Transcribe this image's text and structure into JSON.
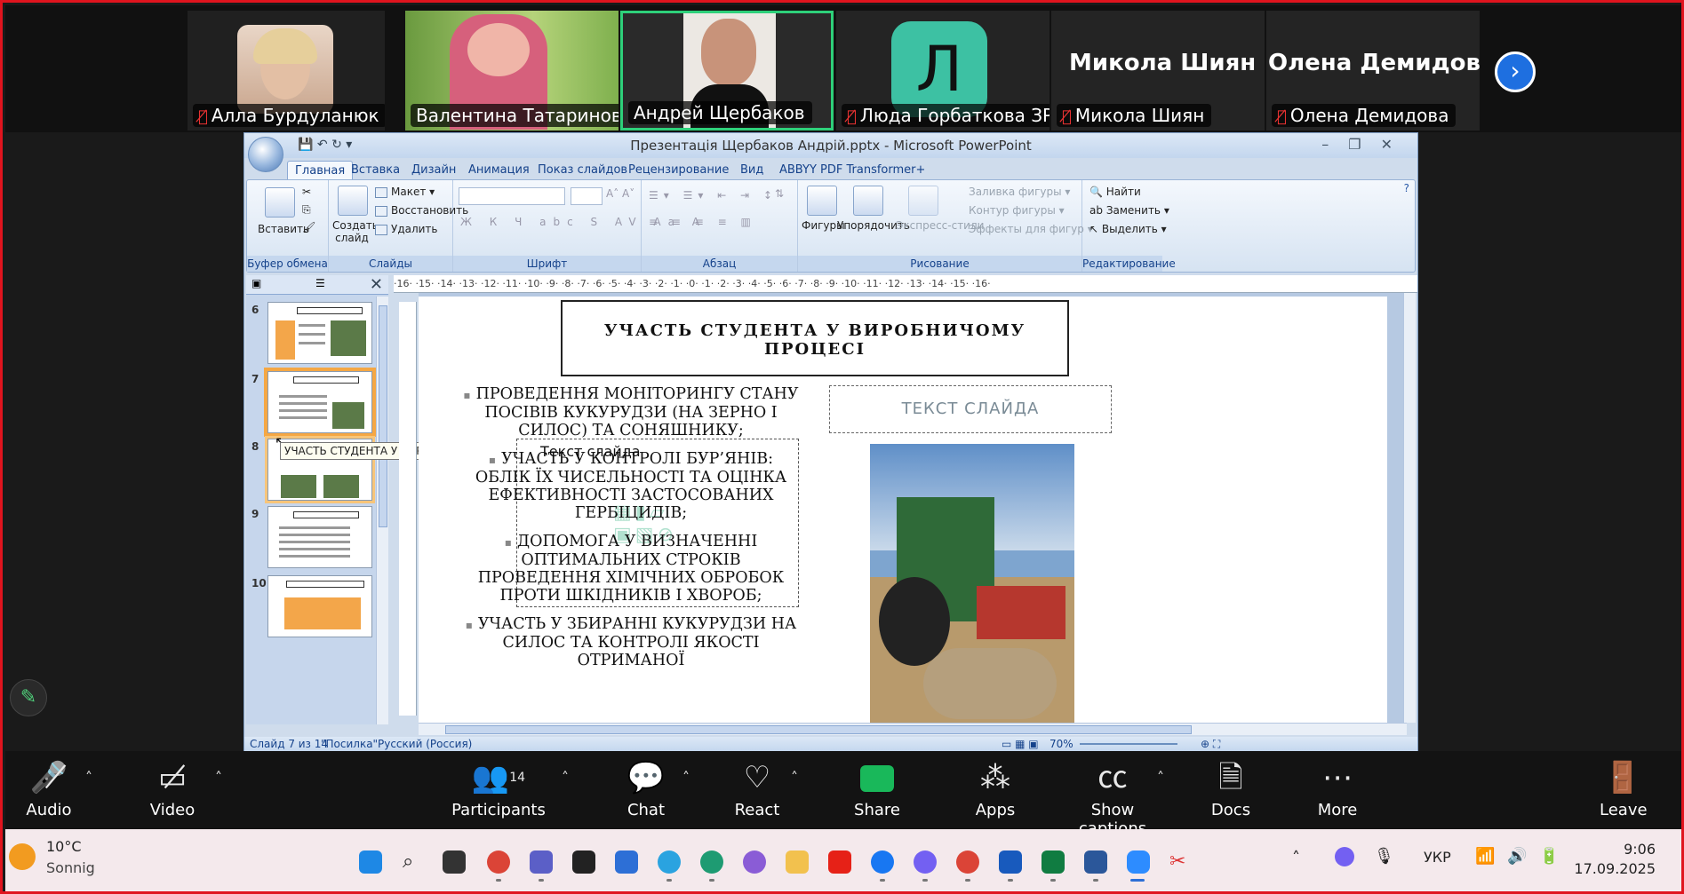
{
  "meeting": {
    "participants": [
      {
        "name": "Алла Бурдуланюк",
        "muted": true
      },
      {
        "name": "Валентина Татаринова",
        "muted": false
      },
      {
        "name": "Андрей Щербаков",
        "muted": false,
        "active_speaker": true
      },
      {
        "name": "Люда Горбаткова ЗР2...",
        "muted": true,
        "avatar_letter": "Л"
      },
      {
        "name": "Микола Шиян",
        "muted": true
      },
      {
        "name": "Олена Демидова",
        "muted": true
      }
    ],
    "next_arrow": "›"
  },
  "ppt": {
    "title": "Презентація Щербаков Андрій.pptx - Microsoft PowerPoint",
    "tabs": [
      "Главная",
      "Вставка",
      "Дизайн",
      "Анимация",
      "Показ слайдов",
      "Рецензирование",
      "Вид",
      "ABBYY PDF Transformer+"
    ],
    "active_tab": "Главная",
    "ribbon": {
      "clipboard": {
        "label": "Буфер обмена",
        "paste": "Вставить"
      },
      "slides": {
        "label": "Слайды",
        "new_slide": "Создать слайд",
        "layout": "Макет",
        "reset": "Восстановить",
        "delete": "Удалить"
      },
      "font": {
        "label": "Шрифт"
      },
      "paragraph": {
        "label": "Абзац"
      },
      "drawing": {
        "label": "Рисование",
        "shapes": "Фигуры",
        "arrange": "Упорядочить",
        "quick_styles": "Экспресс-стили",
        "fill": "Заливка фигуры",
        "outline": "Контур фигуры",
        "effects": "Эффекты для фигур"
      },
      "editing": {
        "label": "Редактирование",
        "find": "Найти",
        "replace": "Заменить",
        "select": "Выделить"
      }
    },
    "ruler_text": "·16· ·15· ·14· ·13· ·12· ·11· ·10· ·9· ·8· ·7· ·6· ·5· ·4· ·3· ·2· ·1· ·0· ·1· ·2· ·3· ·4· ·5· ·6· ·7· ·8· ·9· ·10· ·11· ·12· ·13· ·14· ·15· ·16·",
    "thumbnails": [
      {
        "num": "6",
        "selected": false
      },
      {
        "num": "7",
        "selected": true
      },
      {
        "num": "8",
        "selected": false
      },
      {
        "num": "9",
        "selected": false
      },
      {
        "num": "10",
        "selected": false
      }
    ],
    "tooltip": "УЧАСТЬ СТУДЕНТА У ВИРОБНИ...",
    "slide": {
      "title": "УЧАСТЬ СТУДЕНТА У ВИРОБНИЧОМУ ПРОЦЕСІ",
      "bullets": [
        "ПРОВЕДЕННЯ МОНІТОРИНГУ СТАНУ ПОСІВІВ КУКУРУДЗИ (НА ЗЕРНО І СИЛОС) ТА СОНЯШНИКУ;",
        "УЧАСТЬ У КОНТРОЛІ БУР’ЯНІВ: ОБЛІК ЇХ ЧИСЕЛЬНОСТІ ТА ОЦІНКА ЕФЕКТИВНОСТІ ЗАСТОСОВАНИХ ГЕРБІЦИДІВ;",
        "ДОПОМОГА У ВИЗНАЧЕННІ ОПТИМАЛЬНИХ СТРОКІВ ПРОВЕДЕННЯ ХІМІЧНИХ ОБРОБОК ПРОТИ ШКІДНИКІВ І ХВОРОБ;",
        "УЧАСТЬ У ЗБИРАННІ КУКУРУДЗИ НА СИЛОС ТА КОНТРОЛІ ЯКОСТІ ОТРИМАНОЇ"
      ],
      "placeholder_label": "Текст слайда",
      "text_placeholder": "ТЕКСТ СЛАЙДА"
    },
    "status": {
      "slide": "Слайд 7 из 14",
      "theme": "\"Посилка\"",
      "language": "Русский (Россия)",
      "zoom": "70%"
    }
  },
  "toolbar": {
    "audio": "Audio",
    "video": "Video",
    "participants": "Participants",
    "participants_count": "14",
    "chat": "Chat",
    "react": "React",
    "share": "Share",
    "apps": "Apps",
    "captions": "Show captions",
    "docs": "Docs",
    "more": "More",
    "leave": "Leave"
  },
  "taskbar": {
    "temperature": "10°C",
    "weather": "Sonnig",
    "language": "УКР",
    "time": "9:06",
    "date": "17.09.2025"
  }
}
